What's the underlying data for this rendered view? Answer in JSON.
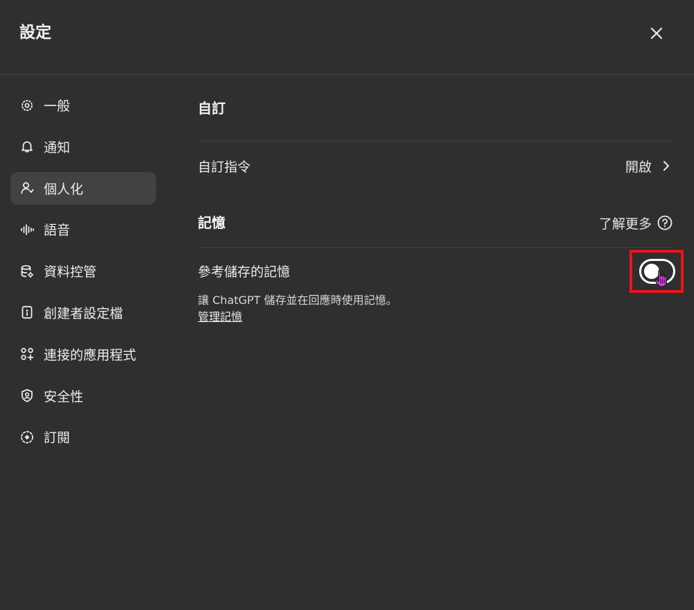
{
  "header": {
    "title": "設定",
    "close_icon": "close-icon"
  },
  "sidebar": {
    "items": [
      {
        "label": "一般",
        "icon": "gear-icon",
        "active": false
      },
      {
        "label": "通知",
        "icon": "bell-icon",
        "active": false
      },
      {
        "label": "個人化",
        "icon": "person-icon",
        "active": true
      },
      {
        "label": "語音",
        "icon": "waveform-icon",
        "active": false
      },
      {
        "label": "資料控管",
        "icon": "database-gear-icon",
        "active": false
      },
      {
        "label": "創建者設定檔",
        "icon": "id-card-icon",
        "active": false
      },
      {
        "label": "連接的應用程式",
        "icon": "apps-icon",
        "active": false
      },
      {
        "label": "安全性",
        "icon": "shield-user-icon",
        "active": false
      },
      {
        "label": "訂閱",
        "icon": "badge-plus-icon",
        "active": false
      }
    ]
  },
  "customize": {
    "title": "自訂",
    "instructions_label": "自訂指令",
    "instructions_status": "開啟"
  },
  "memory": {
    "title": "記憶",
    "learn_more": "了解更多",
    "reference_label": "參考儲存的記憶",
    "description": "讓 ChatGPT 儲存並在回應時使用記憶。",
    "manage_link": "管理記憶",
    "toggle_on": false
  },
  "colors": {
    "background": "#2f2f2f",
    "active_item": "#424242",
    "highlight": "#e8141e",
    "cursor": "#c83fd6"
  }
}
